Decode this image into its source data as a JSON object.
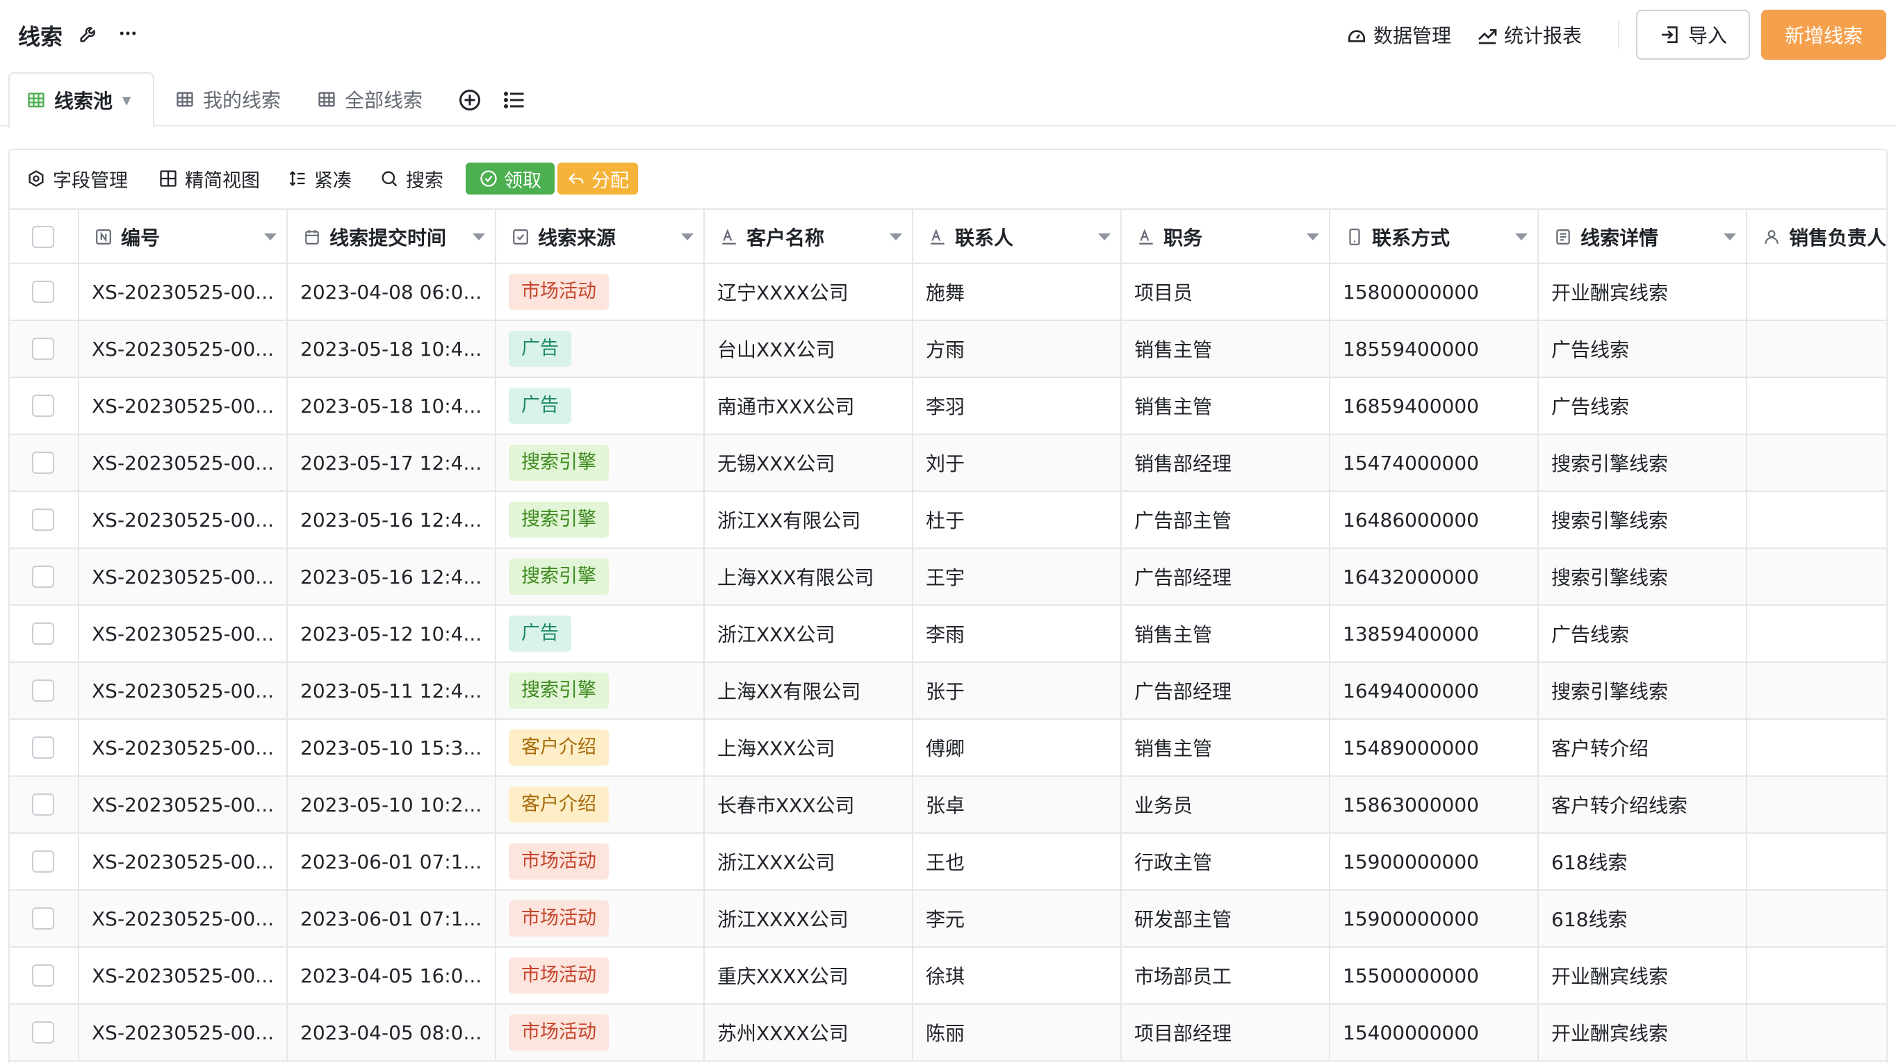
{
  "header": {
    "title": "线索",
    "data_mgmt_label": "数据管理",
    "stats_label": "统计报表",
    "import_label": "导入",
    "new_label": "新增线索"
  },
  "tabs": [
    {
      "label": "线索池",
      "active": true
    },
    {
      "label": "我的线索",
      "active": false
    },
    {
      "label": "全部线索",
      "active": false
    }
  ],
  "toolbar": {
    "field_mgmt": "字段管理",
    "simple_view": "精简视图",
    "compact": "紧凑",
    "search": "搜索",
    "claim": "领取",
    "assign": "分配"
  },
  "colors": {
    "accent": "#f5a04d",
    "claim_green": "#4caf50",
    "assign_orange": "#f5b33a",
    "tag_market_bg": "#fde4dd",
    "tag_ad_bg": "#d9f3ea",
    "tag_search_bg": "#e2f5d6",
    "tag_referral_bg": "#fdeec8"
  },
  "table": {
    "columns": [
      "编号",
      "线索提交时间",
      "线索来源",
      "客户名称",
      "联系人",
      "职务",
      "联系方式",
      "线索详情",
      "销售负责人"
    ],
    "rows": [
      {
        "id": "XS-20230525-00...",
        "time": "2023-04-08 06:0...",
        "source": "市场活动",
        "source_type": "market",
        "customer": "辽宁XXXX公司",
        "contact": "施舞",
        "title": "项目员",
        "phone": "15800000000",
        "detail": "开业酬宾线索"
      },
      {
        "id": "XS-20230525-00...",
        "time": "2023-05-18 10:4...",
        "source": "广告",
        "source_type": "ad",
        "customer": "台山XXX公司",
        "contact": "方雨",
        "title": "销售主管",
        "phone": "18559400000",
        "detail": "广告线索"
      },
      {
        "id": "XS-20230525-00...",
        "time": "2023-05-18 10:4...",
        "source": "广告",
        "source_type": "ad",
        "customer": "南通市XXX公司",
        "contact": "李羽",
        "title": "销售主管",
        "phone": "16859400000",
        "detail": "广告线索"
      },
      {
        "id": "XS-20230525-00...",
        "time": "2023-05-17 12:4...",
        "source": "搜索引擎",
        "source_type": "search",
        "customer": "无锡XXX公司",
        "contact": "刘于",
        "title": "销售部经理",
        "phone": "15474000000",
        "detail": "搜索引擎线索"
      },
      {
        "id": "XS-20230525-00...",
        "time": "2023-05-16 12:4...",
        "source": "搜索引擎",
        "source_type": "search",
        "customer": "浙江XX有限公司",
        "contact": "杜于",
        "title": "广告部主管",
        "phone": "16486000000",
        "detail": "搜索引擎线索"
      },
      {
        "id": "XS-20230525-00...",
        "time": "2023-05-16 12:4...",
        "source": "搜索引擎",
        "source_type": "search",
        "customer": "上海XXX有限公司",
        "contact": "王宇",
        "title": "广告部经理",
        "phone": "16432000000",
        "detail": "搜索引擎线索"
      },
      {
        "id": "XS-20230525-00...",
        "time": "2023-05-12 10:4...",
        "source": "广告",
        "source_type": "ad",
        "customer": "浙江XXX公司",
        "contact": "李雨",
        "title": "销售主管",
        "phone": "13859400000",
        "detail": "广告线索"
      },
      {
        "id": "XS-20230525-00...",
        "time": "2023-05-11 12:4...",
        "source": "搜索引擎",
        "source_type": "search",
        "customer": "上海XX有限公司",
        "contact": "张于",
        "title": "广告部经理",
        "phone": "16494000000",
        "detail": "搜索引擎线索"
      },
      {
        "id": "XS-20230525-00...",
        "time": "2023-05-10 15:3...",
        "source": "客户介绍",
        "source_type": "referral",
        "customer": "上海XXX公司",
        "contact": "傅卿",
        "title": "销售主管",
        "phone": "15489000000",
        "detail": "客户转介绍"
      },
      {
        "id": "XS-20230525-00...",
        "time": "2023-05-10 10:2...",
        "source": "客户介绍",
        "source_type": "referral",
        "customer": "长春市XXX公司",
        "contact": "张卓",
        "title": "业务员",
        "phone": "15863000000",
        "detail": "客户转介绍线索"
      },
      {
        "id": "XS-20230525-00...",
        "time": "2023-06-01 07:1...",
        "source": "市场活动",
        "source_type": "market",
        "customer": "浙江XXX公司",
        "contact": "王也",
        "title": "行政主管",
        "phone": "15900000000",
        "detail": "618线索"
      },
      {
        "id": "XS-20230525-00...",
        "time": "2023-06-01 07:1...",
        "source": "市场活动",
        "source_type": "market",
        "customer": "浙江XXXX公司",
        "contact": "李元",
        "title": "研发部主管",
        "phone": "15900000000",
        "detail": "618线索"
      },
      {
        "id": "XS-20230525-00...",
        "time": "2023-04-05 16:0...",
        "source": "市场活动",
        "source_type": "market",
        "customer": "重庆XXXX公司",
        "contact": "徐琪",
        "title": "市场部员工",
        "phone": "15500000000",
        "detail": "开业酬宾线索"
      },
      {
        "id": "XS-20230525-00...",
        "time": "2023-04-05 08:0...",
        "source": "市场活动",
        "source_type": "market",
        "customer": "苏州XXXX公司",
        "contact": "陈丽",
        "title": "项目部经理",
        "phone": "15400000000",
        "detail": "开业酬宾线索"
      }
    ]
  }
}
